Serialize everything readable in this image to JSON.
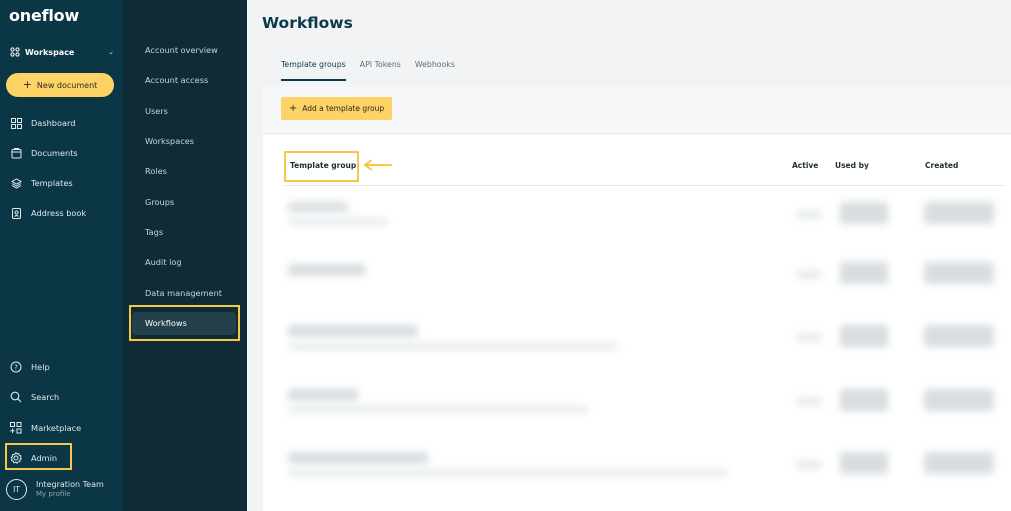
{
  "sidebar": {
    "logo": "oneflow",
    "workspace": "Workspace",
    "new_document": "New document",
    "items": [
      {
        "label": "Dashboard",
        "icon": "dashboard-icon"
      },
      {
        "label": "Documents",
        "icon": "documents-icon"
      },
      {
        "label": "Templates",
        "icon": "templates-icon"
      },
      {
        "label": "Address book",
        "icon": "address-book-icon"
      }
    ],
    "bottom_items": [
      {
        "label": "Help",
        "icon": "help-icon"
      },
      {
        "label": "Search",
        "icon": "search-icon"
      },
      {
        "label": "Marketplace",
        "icon": "marketplace-icon"
      },
      {
        "label": "Admin",
        "icon": "admin-gear-icon"
      }
    ],
    "profile": {
      "initials": "IT",
      "name": "Integration Team",
      "sub": "My profile"
    }
  },
  "admin_menu": {
    "items": [
      "Account overview",
      "Account access",
      "Users",
      "Workspaces",
      "Roles",
      "Groups",
      "Tags",
      "Audit log",
      "Data management",
      "Workflows"
    ],
    "active": "Workflows"
  },
  "main": {
    "title": "Workflows",
    "tabs": [
      {
        "label": "Template groups",
        "active": true
      },
      {
        "label": "API Tokens",
        "active": false
      },
      {
        "label": "Webhooks",
        "active": false
      }
    ],
    "add_button": "Add a template group",
    "columns": [
      "Template group",
      "Active",
      "Used by",
      "Created"
    ]
  },
  "colors": {
    "sidebar_bg": "#0b3645",
    "submenu_bg": "#0f2b36",
    "accent_yellow": "#fdd365",
    "highlight_border": "#f5c849",
    "title": "#0c3a4b"
  }
}
